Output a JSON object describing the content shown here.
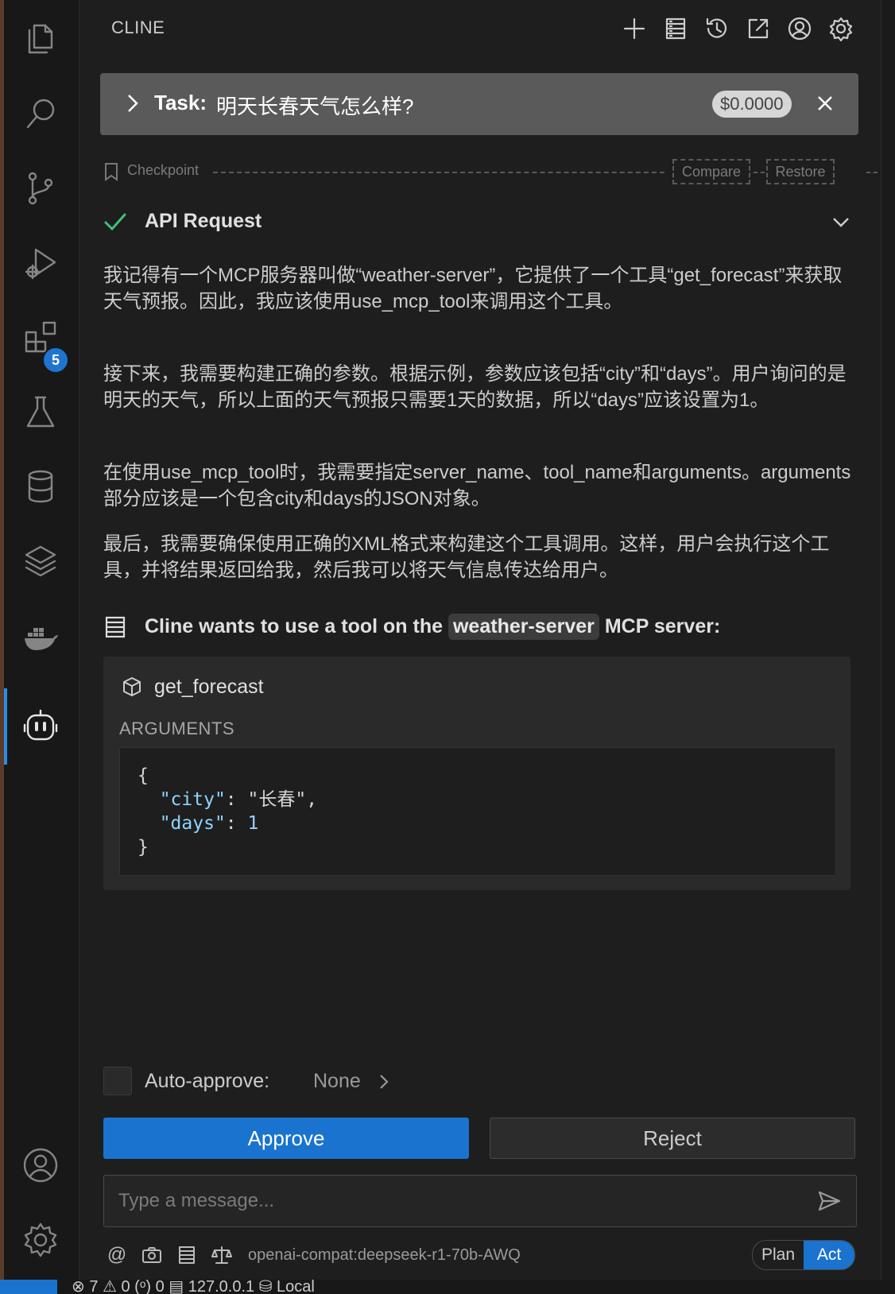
{
  "header": {
    "title": "CLINE"
  },
  "task": {
    "label": "Task:",
    "text": "明天长春天气怎么样?",
    "cost": "$0.0000"
  },
  "checkpoint": {
    "label": "Checkpoint",
    "compare": "Compare",
    "restore": "Restore"
  },
  "api_request": {
    "title": "API Request"
  },
  "thoughts": [
    "我记得有一个MCP服务器叫做“weather-server”，它提供了一个工具“get_forecast”来获取天气预报。因此，我应该使用use_mcp_tool来调用这个工具。",
    "接下来，我需要构建正确的参数。根据示例，参数应该包括“city”和“days”。用户询问的是明天的天气，所以上面的天气预报只需要1天的数据，所以“days”应该设置为1。",
    "在使用use_mcp_tool时，我需要指定server_name、tool_name和arguments。arguments部分应该是一个包含city和days的JSON对象。",
    "最后，我需要确保使用正确的XML格式来构建这个工具调用。这样，用户会执行这个工具，并将结果返回给我，然后我可以将天气信息传达给用户。"
  ],
  "tool_use": {
    "prefix": "Cline wants to use a tool on the",
    "server": "weather-server",
    "suffix": "MCP server:",
    "tool_name": "get_forecast",
    "arguments_label": "ARGUMENTS",
    "code": {
      "open": "{",
      "city_key": "\"city\"",
      "city_value": "\"长春\"",
      "days_key": "\"days\"",
      "days_value": "1",
      "close": "}"
    }
  },
  "auto_approve": {
    "label": "Auto-approve:",
    "value": "None"
  },
  "buttons": {
    "approve": "Approve",
    "reject": "Reject"
  },
  "message": {
    "placeholder": "Type a message..."
  },
  "footer": {
    "at": "@",
    "model": "openai-compat:deepseek-r1-70b-AWQ",
    "plan": "Plan",
    "act": "Act"
  },
  "activity_bar": {
    "extensions_badge": "5"
  },
  "status_bar": {
    "text": "⊗ 7 ⚠ 0   (ᵒ) 0   ▤ 127.0.0.1   ⛁ Local"
  },
  "colors": {
    "accent": "#1a73cf",
    "success": "#3ec27a",
    "background": "#1e1e1e"
  },
  "icons": [
    "files-icon",
    "search-icon",
    "source-control-icon",
    "run-debug-icon",
    "extensions-icon",
    "testing-icon",
    "database-icon",
    "layers-icon",
    "docker-icon",
    "cline-robot-icon",
    "account-icon",
    "settings-icon"
  ]
}
